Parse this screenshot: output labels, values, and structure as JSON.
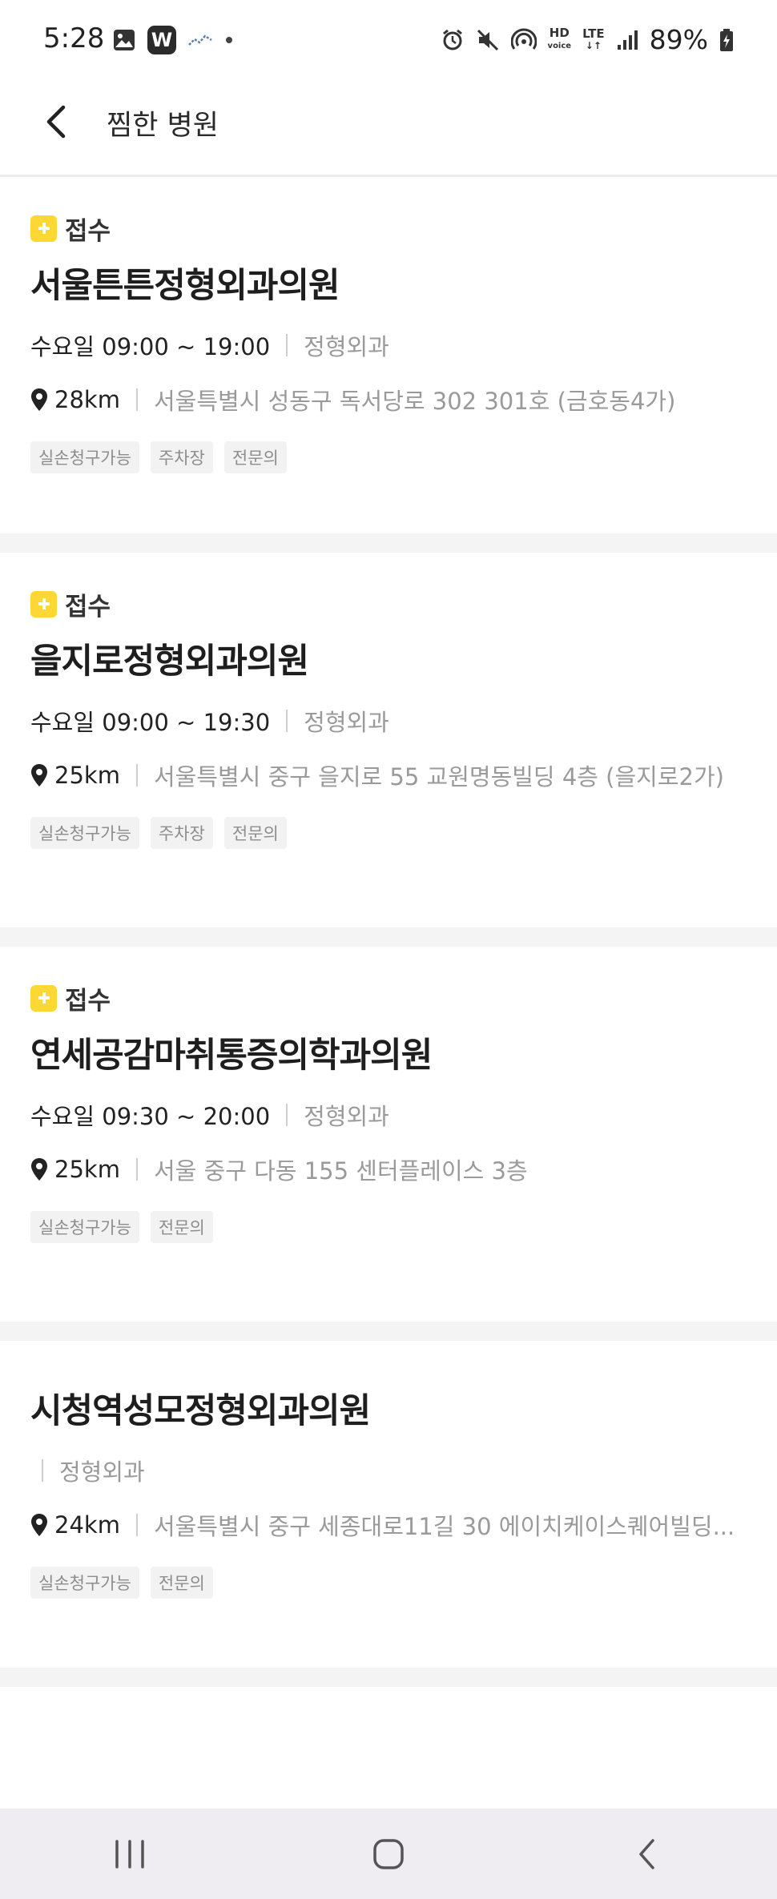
{
  "status_bar": {
    "time": "5:28",
    "w_badge": "W",
    "hd_top": "HD",
    "hd_bottom": "voice",
    "lte_label": "LTE",
    "battery": "89%"
  },
  "app_bar": {
    "title": "찜한 병원",
    "back_icon": "chevron-left-icon"
  },
  "hospitals": [
    {
      "reception": "접수",
      "name": "서울튼튼정형외과의원",
      "hours": "수요일 09:00 ~ 19:00",
      "department": "정형외과",
      "distance": "28km",
      "address": "서울특별시 성동구 독서당로 302 301호 (금호동4가)",
      "tags": [
        "실손청구가능",
        "주차장",
        "전문의"
      ]
    },
    {
      "reception": "접수",
      "name": "을지로정형외과의원",
      "hours": "수요일 09:00 ~ 19:30",
      "department": "정형외과",
      "distance": "25km",
      "address": "서울특별시 중구 을지로 55 교원명동빌딩 4층 (을지로2가)",
      "tags": [
        "실손청구가능",
        "주차장",
        "전문의"
      ]
    },
    {
      "reception": "접수",
      "name": "연세공감마취통증의학과의원",
      "hours": "수요일 09:30 ~ 20:00",
      "department": "정형외과",
      "distance": "25km",
      "address": "서울 중구 다동 155 센터플레이스 3층",
      "tags": [
        "실손청구가능",
        "전문의"
      ]
    },
    {
      "name": "시청역성모정형외과의원",
      "hours": "",
      "department": "정형외과",
      "distance": "24km",
      "address": "서울특별시 중구 세종대로11길 30 에이치케이스퀘어빌딩...",
      "tags": [
        "실손청구가능",
        "전문의"
      ]
    }
  ],
  "nav_bar": {
    "recent_icon": "recent-apps-icon",
    "home_icon": "home-icon",
    "back_icon": "back-icon"
  },
  "colors": {
    "accent_yellow": "#fdd835",
    "divider": "#f4f4f4",
    "nav_bg": "#efedf1"
  }
}
